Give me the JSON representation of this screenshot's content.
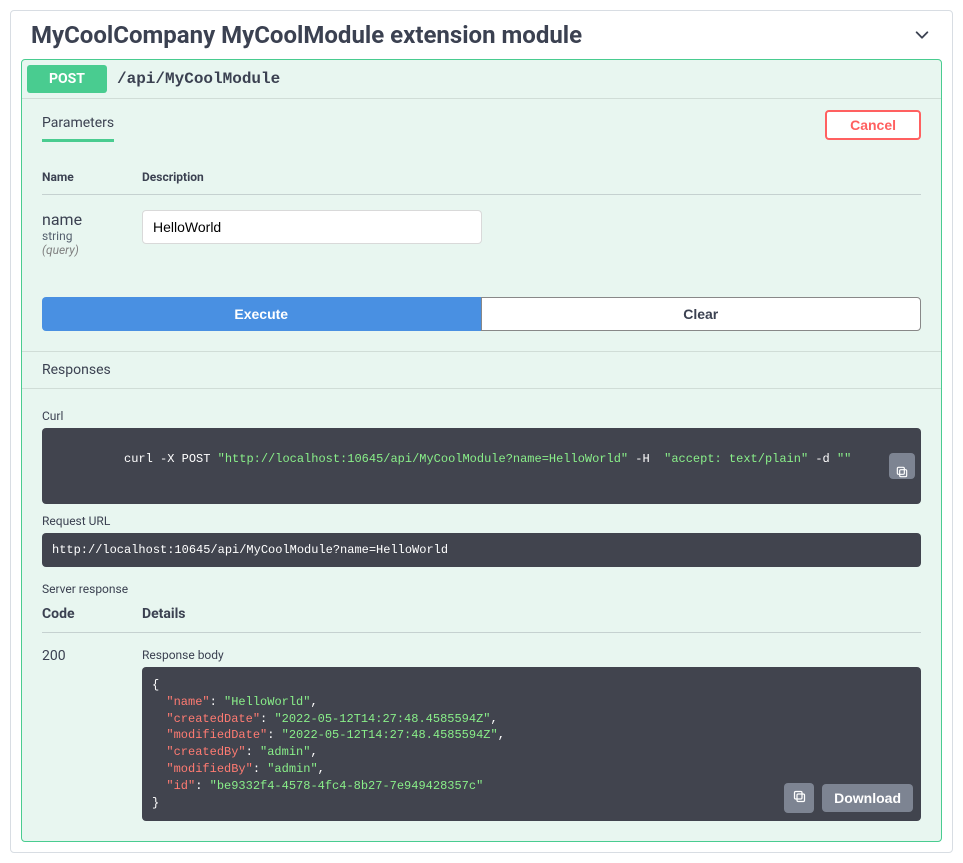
{
  "header": {
    "title": "MyCoolCompany MyCoolModule extension module"
  },
  "operation": {
    "method": "POST",
    "path": "/api/MyCoolModule"
  },
  "tabs": {
    "parameters_label": "Parameters",
    "cancel_label": "Cancel"
  },
  "params": {
    "col_name": "Name",
    "col_desc": "Description",
    "rows": [
      {
        "name": "name",
        "type": "string",
        "in": "(query)",
        "value": "HelloWorld"
      }
    ]
  },
  "actions": {
    "execute_label": "Execute",
    "clear_label": "Clear"
  },
  "responses": {
    "header_label": "Responses",
    "curl_label": "Curl",
    "curl_prefix": "curl -X POST ",
    "curl_url": "\"http://localhost:10645/api/MyCoolModule?name=HelloWorld\"",
    "curl_h_flag": " -H ",
    "curl_accept": " \"accept: text/plain\"",
    "curl_d_flag": " -d ",
    "curl_body": "\"\"",
    "request_url_label": "Request URL",
    "request_url": "http://localhost:10645/api/MyCoolModule?name=HelloWorld",
    "server_response_label": "Server response",
    "col_code": "Code",
    "col_details": "Details",
    "code": "200",
    "body_label": "Response body",
    "download_label": "Download",
    "json": {
      "name": "HelloWorld",
      "createdDate": "2022-05-12T14:27:48.4585594Z",
      "modifiedDate": "2022-05-12T14:27:48.4585594Z",
      "createdBy": "admin",
      "modifiedBy": "admin",
      "id": "be9332f4-4578-4fc4-8b27-7e949428357c"
    }
  }
}
